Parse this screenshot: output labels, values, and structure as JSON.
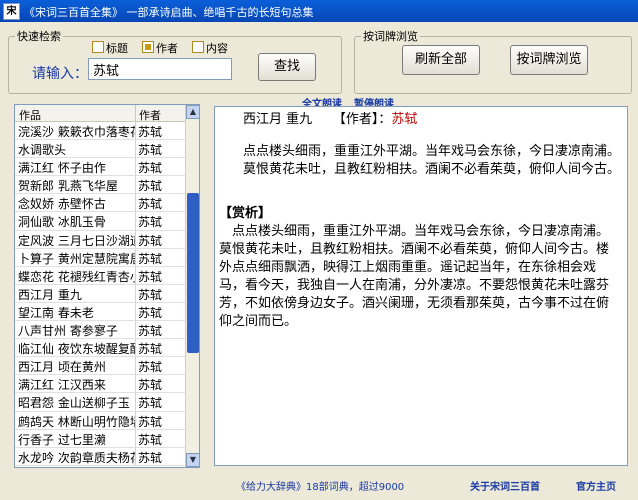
{
  "window": {
    "title": "《宋词三百首全集》 一部承诗启曲、绝唱千古的长短句总集",
    "icon_glyph": "宋"
  },
  "search": {
    "group_label": "快速检索",
    "checkboxes": [
      {
        "label": "标题",
        "checked": false
      },
      {
        "label": "作者",
        "checked": true
      },
      {
        "label": "内容",
        "checked": false
      }
    ],
    "prompt": "请输入：",
    "value": "苏轼",
    "button": "查找"
  },
  "browse": {
    "group_label": "按词牌浏览",
    "refresh_button": "刷新全部",
    "browse_button": "按词牌浏览"
  },
  "list": {
    "headers": [
      "作品",
      "作者"
    ],
    "rows": [
      [
        "浣溪沙 簌簌衣巾落枣花",
        "苏轼"
      ],
      [
        "水调歌头",
        "苏轼"
      ],
      [
        "满江红 怀子由作",
        "苏轼"
      ],
      [
        "贺新郎 乳燕飞华屋",
        "苏轼"
      ],
      [
        "念奴娇 赤壁怀古",
        "苏轼"
      ],
      [
        "洞仙歌 冰肌玉骨",
        "苏轼"
      ],
      [
        "定风波 三月七日沙湖道中",
        "苏轼"
      ],
      [
        "卜算子 黄州定慧院寓居作",
        "苏轼"
      ],
      [
        "蝶恋花 花褪残红青杏小",
        "苏轼"
      ],
      [
        "西江月 重九",
        "苏轼"
      ],
      [
        "望江南 春未老",
        "苏轼"
      ],
      [
        "八声甘州 寄参寥子",
        "苏轼"
      ],
      [
        "临江仙 夜饮东坡醒复醉",
        "苏轼"
      ],
      [
        "西江月 顷在黄州",
        "苏轼"
      ],
      [
        "满江红 江汉西来",
        "苏轼"
      ],
      [
        "昭君怨 金山送柳子玉",
        "苏轼"
      ],
      [
        "鹧鸪天 林断山明竹隐墙",
        "苏轼"
      ],
      [
        "行香子 过七里濑",
        "苏轼"
      ],
      [
        "水龙吟 次韵章质夫杨花词",
        "苏轼"
      ]
    ]
  },
  "reader": {
    "read_all": "全文朗读",
    "pause": "暂停朗读",
    "title": "西江月 重九",
    "author_label": "【作者】：",
    "author": "苏轼",
    "poem": "点点楼头细雨，重重江外平湖。当年戏马会东徐，今日凄凉南浦。莫恨黄花未吐，且教红粉相扶。酒阑不必看茱萸，俯仰人间今古。",
    "appreciation_label": "【赏析】",
    "appreciation": "点点楼头细雨，重重江外平湖。当年戏马会东徐，今日凄凉南浦。莫恨黄花未吐，且教红粉相扶。酒阑不必看茱萸，俯仰人间今古。楼外点点细雨飘洒，映得江上烟雨重重。遥记起当年，在东徐相会戏马，看今天，我独自一人在南浦，分外凄凉。不要怨恨黄花未吐露芬芳，不如依傍身边女子。酒兴阑珊，无须看那茱萸，古今事不过在俯仰之间而已。"
  },
  "footer": {
    "left": "《给力大辞典》18部词典，超过9000",
    "about": "关于宋词三百首",
    "homepage": "官方主页"
  }
}
